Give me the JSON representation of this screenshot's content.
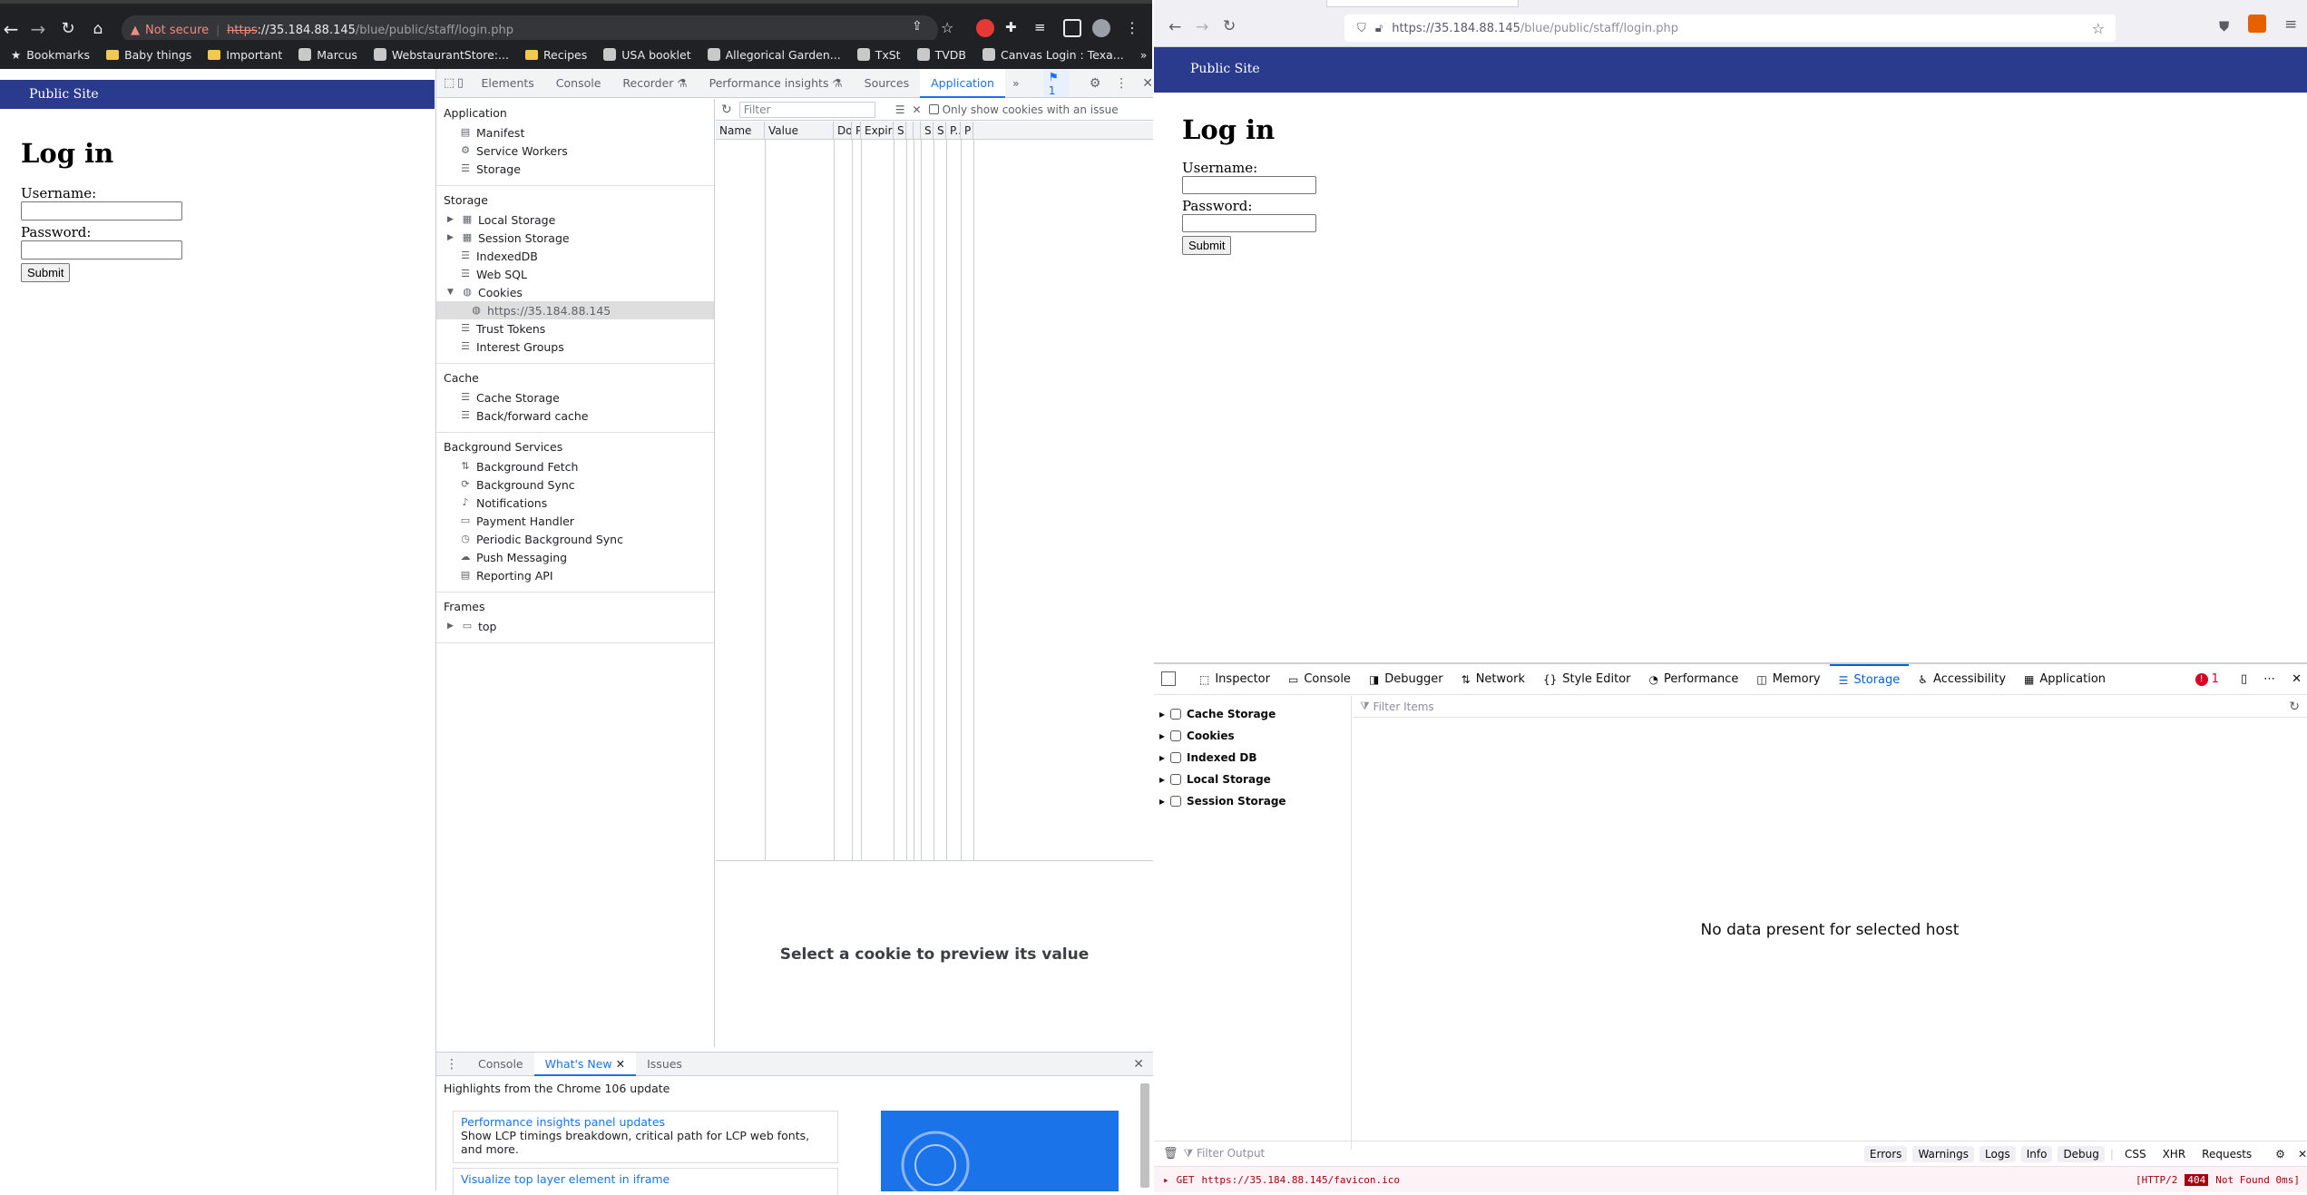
{
  "chrome": {
    "url_scheme": "https",
    "url_host": "://35.184.88.145",
    "url_path": "/blue/public/staff/login.php",
    "security_label": "Not secure",
    "bookmarks": [
      {
        "label": "Bookmarks",
        "kind": "star"
      },
      {
        "label": "Baby things",
        "kind": "folder"
      },
      {
        "label": "Important",
        "kind": "folder"
      },
      {
        "label": "Marcus",
        "kind": "icon"
      },
      {
        "label": "WebstaurantStore:...",
        "kind": "icon"
      },
      {
        "label": "Recipes",
        "kind": "folder"
      },
      {
        "label": "USA booklet",
        "kind": "icon"
      },
      {
        "label": "Allegorical Garden...",
        "kind": "icon"
      },
      {
        "label": "TxSt",
        "kind": "icon"
      },
      {
        "label": "TVDB",
        "kind": "icon"
      },
      {
        "label": "Canvas Login : Texa...",
        "kind": "icon"
      }
    ],
    "more_bookmarks": "»"
  },
  "page": {
    "nav_title": "Public Site",
    "heading": "Log in",
    "username_label": "Username:",
    "password_label": "Password:",
    "submit_label": "Submit"
  },
  "devtools": {
    "tabs": [
      "Elements",
      "Console",
      "Recorder ⚗",
      "Performance insights ⚗",
      "Sources",
      "Application"
    ],
    "active_tab": "Application",
    "more_tabs": "»",
    "issues_count": "1",
    "sections": [
      {
        "title": "Application",
        "items": [
          {
            "label": "Manifest",
            "icon": "file-icon"
          },
          {
            "label": "Service Workers",
            "icon": "gear-icon"
          },
          {
            "label": "Storage",
            "icon": "database-icon"
          }
        ]
      },
      {
        "title": "Storage",
        "items": [
          {
            "label": "Local Storage",
            "icon": "grid-icon",
            "expandable": "collapsed"
          },
          {
            "label": "Session Storage",
            "icon": "grid-icon",
            "expandable": "collapsed"
          },
          {
            "label": "IndexedDB",
            "icon": "database-icon"
          },
          {
            "label": "Web SQL",
            "icon": "database-icon"
          },
          {
            "label": "Cookies",
            "icon": "cookie-icon",
            "expandable": "expanded"
          },
          {
            "label": "https://35.184.88.145",
            "icon": "cookie-icon",
            "level": 2,
            "selected": true
          },
          {
            "label": "Trust Tokens",
            "icon": "database-icon"
          },
          {
            "label": "Interest Groups",
            "icon": "database-icon"
          }
        ]
      },
      {
        "title": "Cache",
        "items": [
          {
            "label": "Cache Storage",
            "icon": "database-icon"
          },
          {
            "label": "Back/forward cache",
            "icon": "database-icon"
          }
        ]
      },
      {
        "title": "Background Services",
        "items": [
          {
            "label": "Background Fetch",
            "icon": "arrows-updown-icon"
          },
          {
            "label": "Background Sync",
            "icon": "sync-icon"
          },
          {
            "label": "Notifications",
            "icon": "bell-icon"
          },
          {
            "label": "Payment Handler",
            "icon": "card-icon"
          },
          {
            "label": "Periodic Background Sync",
            "icon": "clock-icon"
          },
          {
            "label": "Push Messaging",
            "icon": "cloud-icon"
          },
          {
            "label": "Reporting API",
            "icon": "file-icon"
          }
        ]
      },
      {
        "title": "Frames",
        "items": [
          {
            "label": "top",
            "icon": "frame-icon",
            "expandable": "collapsed"
          }
        ]
      }
    ],
    "filter_placeholder": "Filter",
    "only_issue_label": "Only show cookies with an issue",
    "columns": [
      "Name",
      "Value",
      "Do...",
      "P",
      "Expires...",
      "S...",
      "",
      "",
      "S...",
      "S...",
      "P...",
      "P"
    ],
    "preview_text": "Select a cookie to preview its value",
    "drawer": {
      "tabs": [
        "Console",
        "What's New",
        "Issues"
      ],
      "active_tab": "What's New",
      "highlight": "Highlights from the Chrome 106 update",
      "card1_title": "Performance insights panel updates",
      "card1_text": "Show LCP timings breakdown, critical path for LCP web fonts, and more.",
      "card2_title": "Visualize top layer element in iframe"
    }
  },
  "firefox": {
    "url_host": "https://35.184.88.145",
    "url_path": "/blue/public/staff/login.php",
    "devtools_tabs": [
      "Inspector",
      "Console",
      "Debugger",
      "Network",
      "Style Editor",
      "Performance",
      "Memory",
      "Storage",
      "Accessibility",
      "Application"
    ],
    "active_tab": "Storage",
    "error_count": "1",
    "filter_placeholder": "Filter Items",
    "storage_items": [
      "Cache Storage",
      "Cookies",
      "Indexed DB",
      "Local Storage",
      "Session Storage"
    ],
    "empty_text": "No data present for selected host",
    "console_filter_placeholder": "Filter Output",
    "console_buttons": [
      "Errors",
      "Warnings",
      "Logs",
      "Info",
      "Debug"
    ],
    "console_extra": [
      "CSS",
      "XHR",
      "Requests"
    ],
    "log_method": "GET",
    "log_url": "https://35.184.88.145/favicon.ico",
    "log_protocol": "[HTTP/2",
    "log_status": "404",
    "log_status_text": "Not Found 0ms]"
  }
}
